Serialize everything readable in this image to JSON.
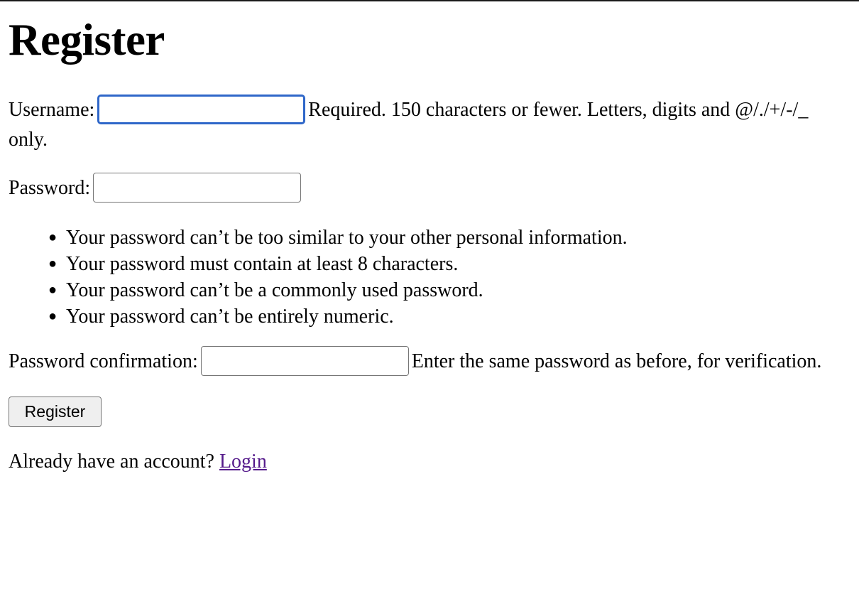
{
  "page": {
    "title": "Register"
  },
  "form": {
    "username": {
      "label": "Username:",
      "value": "",
      "help": "Required. 150 characters or fewer. Letters, digits and @/./+/-/_ only."
    },
    "password": {
      "label": "Password:",
      "value": "",
      "help_items": [
        "Your password can’t be too similar to your other personal information.",
        "Your password must contain at least 8 characters.",
        "Your password can’t be a commonly used password.",
        "Your password can’t be entirely numeric."
      ]
    },
    "password_confirmation": {
      "label": "Password confirmation:",
      "value": "",
      "help": "Enter the same password as before, for verification."
    },
    "submit_label": "Register"
  },
  "footer": {
    "prompt": "Already have an account?",
    "login_link": "Login"
  },
  "colors": {
    "focus_ring": "#2f67c9",
    "visited_link": "#551a8b",
    "button_bg": "#efefef"
  }
}
